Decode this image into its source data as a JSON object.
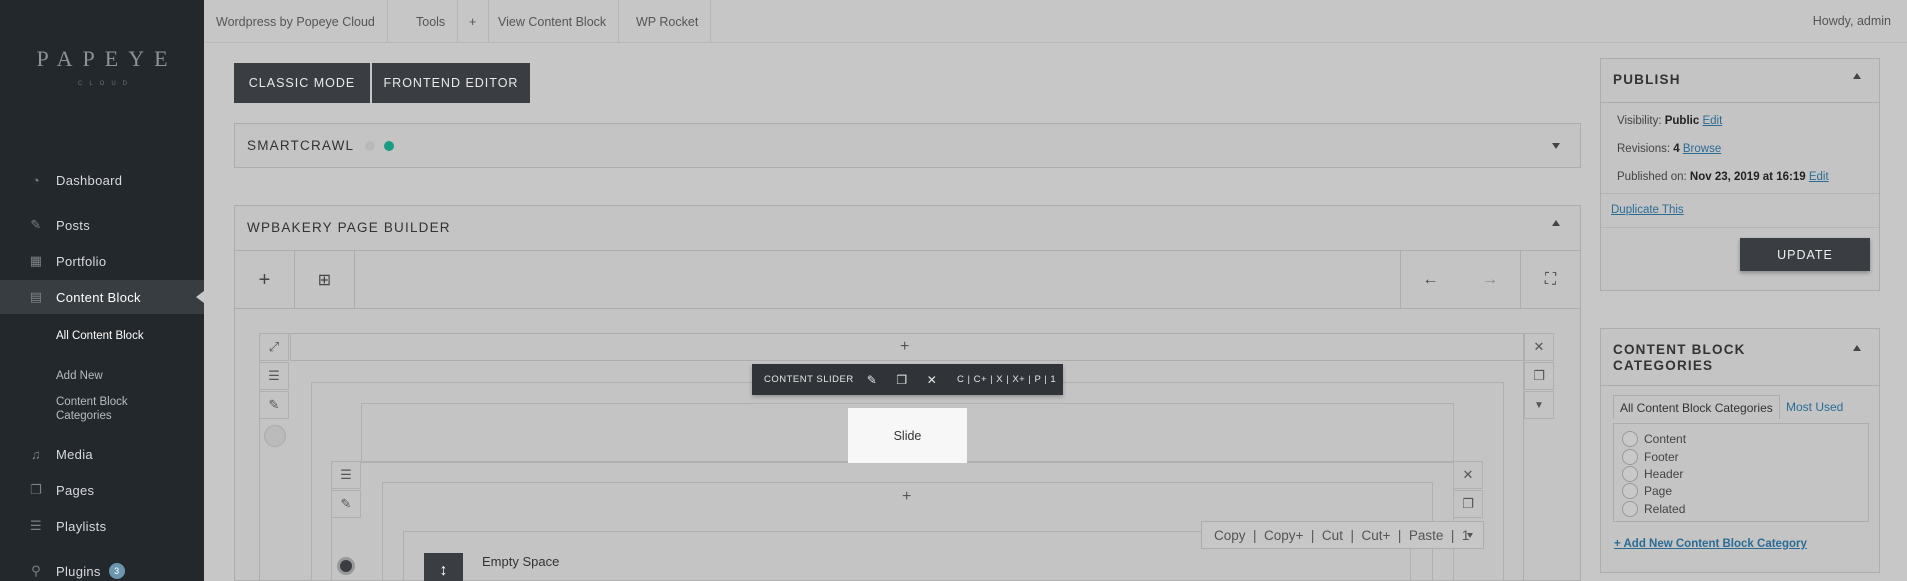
{
  "sidebar": {
    "logo_main": "PAPEYE",
    "logo_sub": "CLOUD",
    "items": [
      {
        "label": "Dashboard",
        "icon": "dashboard-icon"
      },
      {
        "label": "Posts",
        "icon": "pin-icon"
      },
      {
        "label": "Portfolio",
        "icon": "portfolio-icon"
      },
      {
        "label": "Content Block",
        "icon": "content-block-icon"
      },
      {
        "label": "Media",
        "icon": "media-icon"
      },
      {
        "label": "Pages",
        "icon": "pages-icon"
      },
      {
        "label": "Playlists",
        "icon": "playlist-icon"
      },
      {
        "label": "Plugins",
        "icon": "plugin-icon",
        "badge": "3"
      }
    ],
    "submenu": [
      "All Content Block",
      "Add New",
      "Content Block Categories"
    ]
  },
  "adminbar": {
    "items": [
      "Wordpress by Popeye Cloud",
      "Tools",
      "+",
      "View Content Block",
      "WP Rocket"
    ],
    "howdy": "Howdy, admin"
  },
  "modes": {
    "classic": "CLASSIC MODE",
    "frontend": "FRONTEND EDITOR"
  },
  "smartcrawl": {
    "title": "SMARTCRAWL",
    "dot_colors": [
      "#b9b9b9",
      "#1a9c84"
    ]
  },
  "builder": {
    "title": "WPBAKERY PAGE BUILDER",
    "float_toolbar": {
      "label": "CONTENT SLIDER",
      "shortcuts": "C | C+ | X | X+ | P | 1"
    },
    "slide_tab": "Slide",
    "paste_bar": "Copy  |  Copy+  |  Cut  |  Cut+  |  Paste  |  1",
    "element": "Empty Space"
  },
  "publish": {
    "title": "PUBLISH",
    "visibility_label": "Visibility:",
    "visibility_value": "Public",
    "revisions_label": "Revisions:",
    "revisions_value": "4",
    "published_label": "Published on:",
    "published_value": "Nov 23, 2019 at 16:19",
    "edit": "Edit",
    "browse": "Browse",
    "duplicate": "Duplicate This",
    "update": "UPDATE"
  },
  "categories": {
    "title": "CONTENT BLOCK CATEGORIES",
    "tab_all": "All Content Block Categories",
    "tab_used": "Most Used",
    "items": [
      "Content",
      "Footer",
      "Header",
      "Page",
      "Related"
    ],
    "add_new": "+ Add New Content Block Category"
  }
}
